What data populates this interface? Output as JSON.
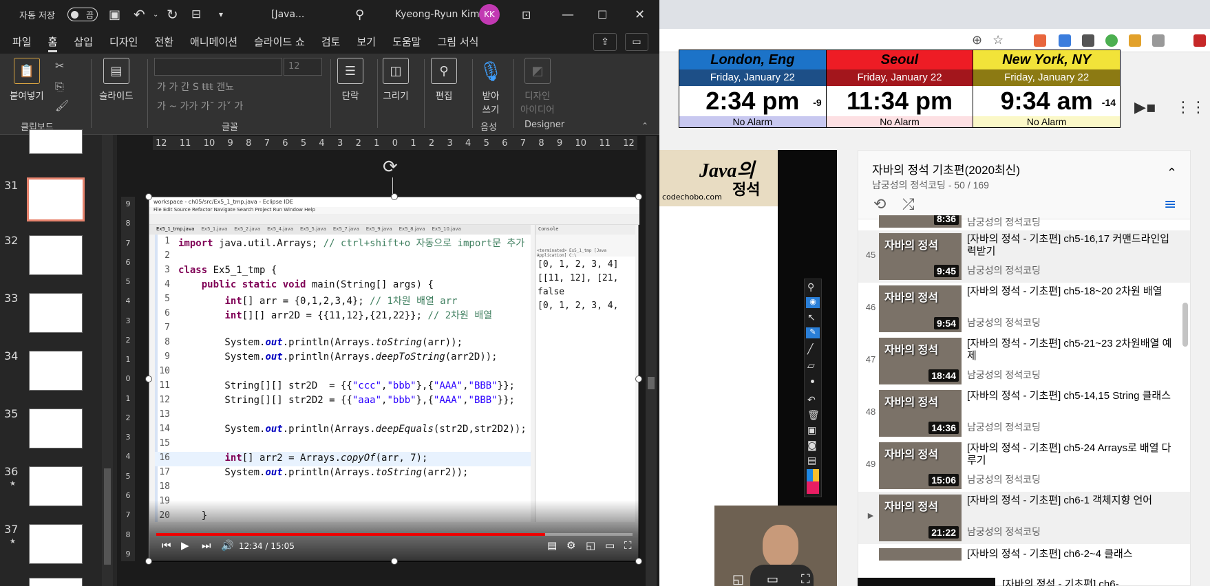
{
  "ppt": {
    "autosave_label": "자동 저장",
    "autosave_state": "끔",
    "doc_title": "[Java...",
    "user_name": "Kyeong-Ryun Kim",
    "user_initials": "KK",
    "tabs": [
      "파일",
      "홈",
      "삽입",
      "디자인",
      "전환",
      "애니메이션",
      "슬라이드 쇼",
      "검토",
      "보기",
      "도움말",
      "그림 서식"
    ],
    "active_tab": "홈",
    "ribbon": {
      "paste": "붙여넣기",
      "slide": "슬라이드",
      "paragraph": "단락",
      "drawing": "그리기",
      "editing": "편집",
      "dictate_1": "받아",
      "dictate_2": "쓰기",
      "design_ideas_1": "디자인",
      "design_ideas_2": "아이디어",
      "font_size": "12",
      "group_clipboard": "클립보드",
      "group_font": "글꼴",
      "group_voice": "음성",
      "group_designer": "Designer",
      "font_row1": "가  가  간  S  ŧŧŧ  갠뇨",
      "font_row2": "가 ~  가가  가˘  가˅  가"
    },
    "thumbs": [
      {
        "num": "31",
        "star": ""
      },
      {
        "num": "32",
        "star": ""
      },
      {
        "num": "33",
        "star": ""
      },
      {
        "num": "34",
        "star": ""
      },
      {
        "num": "35",
        "star": ""
      },
      {
        "num": "36",
        "star": "★"
      },
      {
        "num": "37",
        "star": "★"
      }
    ],
    "ruler_h": [
      "12",
      "11",
      "10",
      "9",
      "8",
      "7",
      "6",
      "5",
      "4",
      "3",
      "2",
      "1",
      "0",
      "1",
      "2",
      "3",
      "4",
      "5",
      "6",
      "7",
      "8",
      "9",
      "10",
      "11",
      "12"
    ],
    "ruler_v": [
      "9",
      "8",
      "7",
      "6",
      "5",
      "4",
      "3",
      "2",
      "1",
      "0",
      "1",
      "2",
      "3",
      "4",
      "5",
      "6",
      "7",
      "8",
      "9"
    ]
  },
  "slide": {
    "eclipse_title": "workspace - ch05/src/Ex5_1_tmp.java - Eclipse IDE",
    "eclipse_menu": "File  Edit  Source  Refactor  Navigate  Search  Project  Run  Window  Help",
    "editor_tabs": [
      "Ex5_1_tmp.java",
      "Ex5_1.java",
      "Ex5_2.java",
      "Ex5_4.java",
      "Ex5_5.java",
      "Ex5_7.java",
      "Ex5_9.java",
      "Ex5_8.java",
      "Ex5_10.java"
    ],
    "console_label": "Console",
    "console_sub": "<terminated> Ex5_1_tmp [Java Application] C:\\",
    "console_out": "[0, 1, 2, 3, 4]\n[[11, 12], [21,\nfalse\n[0, 1, 2, 3, 4,",
    "video_time": "12:34 / 15:05",
    "progress": 0.817
  },
  "clock": [
    {
      "city": "London, Eng",
      "date": "Friday, January 22",
      "time": "2:34 pm",
      "offset": "-9",
      "alarm": "No Alarm",
      "head": "#1c73c8",
      "datebg": "#1d4f87",
      "alarmbg": "#c8c8f0"
    },
    {
      "city": "Seoul",
      "date": "Friday, January 22",
      "time": "11:34 pm",
      "offset": "",
      "alarm": "No Alarm",
      "head": "#ee1c25",
      "datebg": "#a3161c",
      "alarmbg": "#fde0e3"
    },
    {
      "city": "New York, NY",
      "date": "Friday, January 22",
      "time": "9:34 am",
      "offset": "-14",
      "alarm": "No Alarm",
      "head": "#f2e339",
      "datebg": "#8c7a13",
      "alarmbg": "#fbf8c8"
    }
  ],
  "video": {
    "logo_title": "Java의",
    "logo_sub": "정석",
    "logo_url": "codechobo.com"
  },
  "playlist": {
    "title": "자바의 정석 기초편(2020최신)",
    "meta": "남궁성의 정석코딩 - 50 / 169",
    "partial_top_channel": "남궁성의 정석코딩",
    "partial_top_dur": "8:36",
    "items": [
      {
        "idx": "45",
        "title": "[자바의 정석 - 기초편] ch5-16,17 커맨드라인입력받기",
        "channel": "남궁성의 정석코딩",
        "dur": "9:45",
        "code": "ch5-16,17"
      },
      {
        "idx": "46",
        "title": "[자바의 정석 - 기초편] ch5-18~20 2차원 배열",
        "channel": "남궁성의 정석코딩",
        "dur": "9:54",
        "code": "ch5-18~20"
      },
      {
        "idx": "47",
        "title": "[자바의 정석 - 기초편] ch5-21~23 2차원배열 예제",
        "channel": "남궁성의 정석코딩",
        "dur": "18:44",
        "code": "ch5-21~23"
      },
      {
        "idx": "48",
        "title": "[자바의 정석 - 기초편] ch5-14,15 String 클래스",
        "channel": "남궁성의 정석코딩",
        "dur": "14:36",
        "code": "ch5-14,15"
      },
      {
        "idx": "49",
        "title": "[자바의 정석 - 기초편] ch5-24 Arrays로 배열 다루기",
        "channel": "남궁성의 정석코딩",
        "dur": "15:06",
        "code": "ch5-24"
      },
      {
        "idx": "▶",
        "title": "[자바의 정석 - 기초편] ch6-1 객체지향 언어",
        "channel": "",
        "dur": "21:22",
        "code": "ch6-1"
      }
    ],
    "partial_bottom_title": "[자바의 정석 - 기초편] ch6-2~4 클래스"
  },
  "thumb_label": "자바의 정석"
}
